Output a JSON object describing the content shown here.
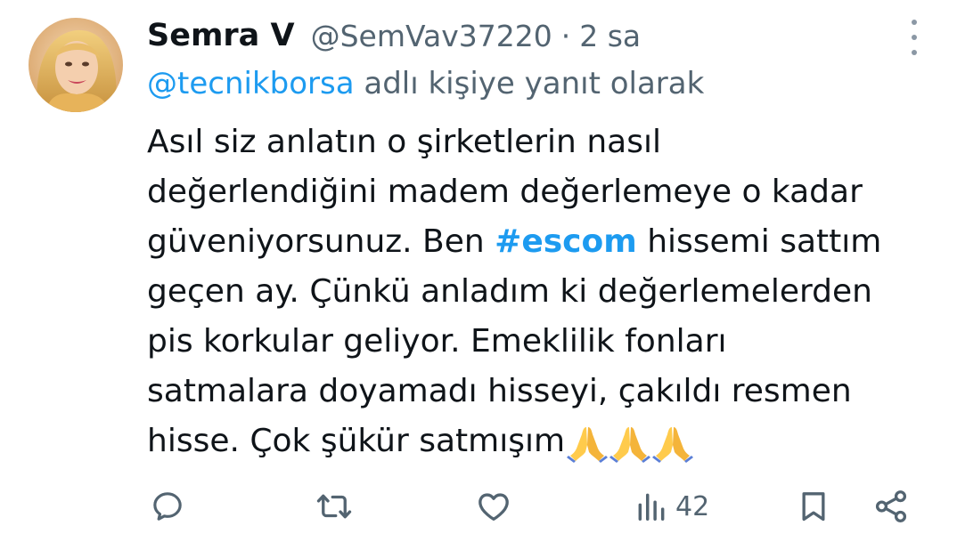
{
  "tweet": {
    "author": {
      "display_name": "Semra V",
      "handle": "@SemVav37220",
      "separator": "·",
      "time": "2 sa"
    },
    "reply_to": {
      "mention": "@tecnikborsa",
      "suffix": " adlı kişiye yanıt olarak"
    },
    "body": {
      "line1": "Asıl siz anlatın o şirketlerin nasıl",
      "line2": "değerlendiğini madem değerlemeye o kadar",
      "line3_before": "güveniyorsunuz. Ben ",
      "hashtag": "#escom",
      "line3_after": " hissemi sattım",
      "line4": "geçen ay. Çünkü anladım ki değerlemelerden",
      "line5": "pis korkular geliyor. Emeklilik fonları",
      "line6": "satmalara doyamadı hisseyi, çakıldı resmen",
      "line7": "hisse. Çok şükür satmışım",
      "emoji_icons": [
        "folded-hands-icon",
        "folded-hands-icon",
        "folded-hands-icon"
      ]
    },
    "actions": {
      "reply_icon": "reply-icon",
      "retweet_icon": "retweet-icon",
      "like_icon": "heart-icon",
      "views_icon": "views-chart-icon",
      "views_count": "42",
      "bookmark_icon": "bookmark-icon",
      "share_icon": "share-icon"
    },
    "colors": {
      "accent": "#1d9bf0",
      "text": "#0f1419",
      "muted": "#536471"
    }
  }
}
